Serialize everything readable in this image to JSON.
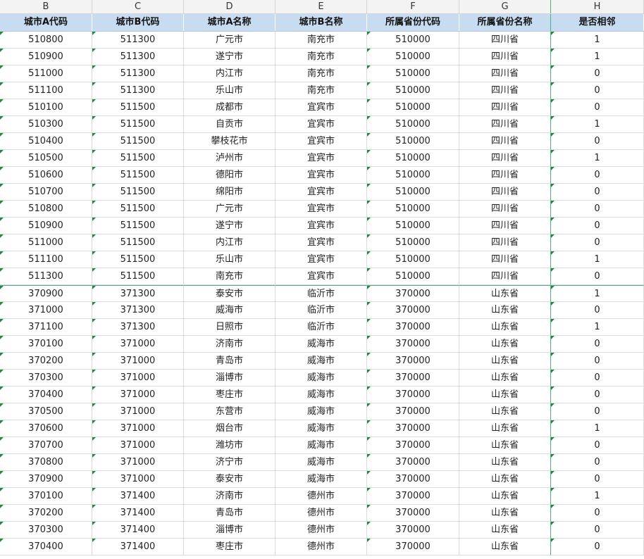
{
  "columns": [
    "B",
    "C",
    "D",
    "E",
    "F",
    "G",
    "H"
  ],
  "headers": [
    "城市A代码",
    "城市B代码",
    "城市A名称",
    "城市B名称",
    "所属省份代码",
    "所属省份名称",
    "是否相邻"
  ],
  "rows": [
    [
      "510800",
      "511300",
      "广元市",
      "南充市",
      "510000",
      "四川省",
      "1"
    ],
    [
      "510900",
      "511300",
      "遂宁市",
      "南充市",
      "510000",
      "四川省",
      "1"
    ],
    [
      "511000",
      "511300",
      "内江市",
      "南充市",
      "510000",
      "四川省",
      "0"
    ],
    [
      "511100",
      "511300",
      "乐山市",
      "南充市",
      "510000",
      "四川省",
      "0"
    ],
    [
      "510100",
      "511500",
      "成都市",
      "宜宾市",
      "510000",
      "四川省",
      "0"
    ],
    [
      "510300",
      "511500",
      "自贡市",
      "宜宾市",
      "510000",
      "四川省",
      "1"
    ],
    [
      "510400",
      "511500",
      "攀枝花市",
      "宜宾市",
      "510000",
      "四川省",
      "0"
    ],
    [
      "510500",
      "511500",
      "泸州市",
      "宜宾市",
      "510000",
      "四川省",
      "1"
    ],
    [
      "510600",
      "511500",
      "德阳市",
      "宜宾市",
      "510000",
      "四川省",
      "0"
    ],
    [
      "510700",
      "511500",
      "绵阳市",
      "宜宾市",
      "510000",
      "四川省",
      "0"
    ],
    [
      "510800",
      "511500",
      "广元市",
      "宜宾市",
      "510000",
      "四川省",
      "0"
    ],
    [
      "510900",
      "511500",
      "遂宁市",
      "宜宾市",
      "510000",
      "四川省",
      "0"
    ],
    [
      "511000",
      "511500",
      "内江市",
      "宜宾市",
      "510000",
      "四川省",
      "0"
    ],
    [
      "511100",
      "511500",
      "乐山市",
      "宜宾市",
      "510000",
      "四川省",
      "1"
    ],
    [
      "511300",
      "511500",
      "南充市",
      "宜宾市",
      "510000",
      "四川省",
      "0"
    ],
    [
      "370900",
      "371300",
      "泰安市",
      "临沂市",
      "370000",
      "山东省",
      "1"
    ],
    [
      "371000",
      "371300",
      "威海市",
      "临沂市",
      "370000",
      "山东省",
      "0"
    ],
    [
      "371100",
      "371300",
      "日照市",
      "临沂市",
      "370000",
      "山东省",
      "1"
    ],
    [
      "370100",
      "371000",
      "济南市",
      "威海市",
      "370000",
      "山东省",
      "0"
    ],
    [
      "370200",
      "371000",
      "青岛市",
      "威海市",
      "370000",
      "山东省",
      "0"
    ],
    [
      "370300",
      "371000",
      "淄博市",
      "威海市",
      "370000",
      "山东省",
      "0"
    ],
    [
      "370400",
      "371000",
      "枣庄市",
      "威海市",
      "370000",
      "山东省",
      "0"
    ],
    [
      "370500",
      "371000",
      "东营市",
      "威海市",
      "370000",
      "山东省",
      "0"
    ],
    [
      "370600",
      "371000",
      "烟台市",
      "威海市",
      "370000",
      "山东省",
      "1"
    ],
    [
      "370700",
      "371000",
      "潍坊市",
      "威海市",
      "370000",
      "山东省",
      "0"
    ],
    [
      "370800",
      "371000",
      "济宁市",
      "威海市",
      "370000",
      "山东省",
      "0"
    ],
    [
      "370900",
      "371000",
      "泰安市",
      "威海市",
      "370000",
      "山东省",
      "0"
    ],
    [
      "370100",
      "371400",
      "济南市",
      "德州市",
      "370000",
      "山东省",
      "1"
    ],
    [
      "370200",
      "371400",
      "青岛市",
      "德州市",
      "370000",
      "山东省",
      "0"
    ],
    [
      "370300",
      "371400",
      "淄博市",
      "德州市",
      "370000",
      "山东省",
      "0"
    ],
    [
      "370400",
      "371400",
      "枣庄市",
      "德州市",
      "370000",
      "山东省",
      "0"
    ]
  ]
}
